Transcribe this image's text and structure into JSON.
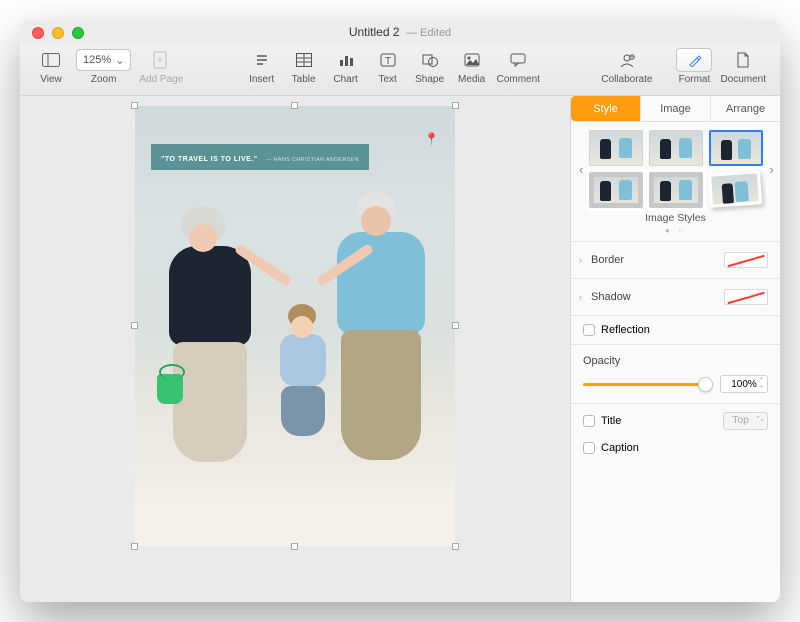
{
  "title": {
    "name": "Untitled 2",
    "status": "Edited"
  },
  "toolbar": {
    "view": "View",
    "zoom_value": "125%",
    "zoom": "Zoom",
    "addpage": "Add Page",
    "insert": "Insert",
    "table": "Table",
    "chart": "Chart",
    "text": "Text",
    "shape": "Shape",
    "media": "Media",
    "comment": "Comment",
    "collaborate": "Collaborate",
    "format": "Format",
    "document": "Document"
  },
  "canvas": {
    "quote": "\"TO TRAVEL IS TO LIVE.\"",
    "byline": "— HANS CHRISTIAN ANDERSEN"
  },
  "sidebar": {
    "tabs": {
      "style": "Style",
      "image": "Image",
      "arrange": "Arrange"
    },
    "styles_label": "Image Styles",
    "border": "Border",
    "shadow": "Shadow",
    "reflection": "Reflection",
    "opacity_label": "Opacity",
    "opacity_value": "100%",
    "title_label": "Title",
    "title_position": "Top",
    "caption_label": "Caption"
  }
}
